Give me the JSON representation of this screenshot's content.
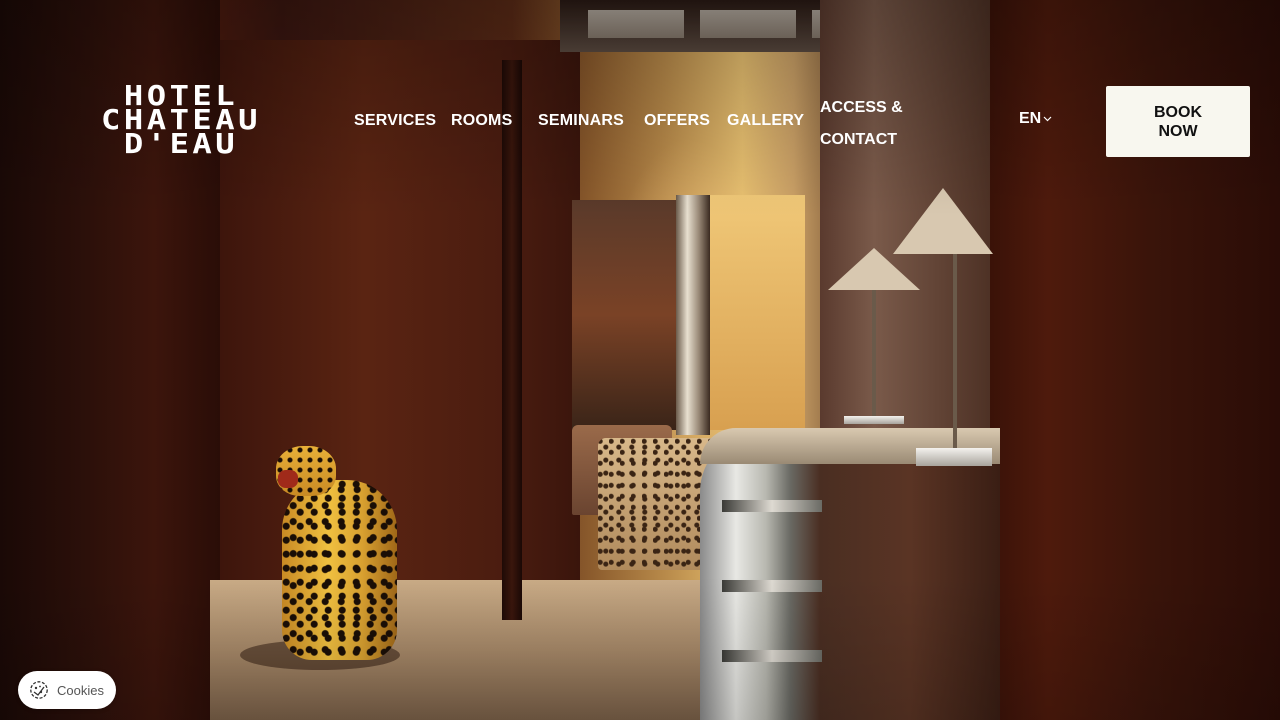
{
  "brand": {
    "logo_line1": "HOTEL",
    "logo_line2": "CHATEAU",
    "logo_line3": "D'EAU"
  },
  "nav": {
    "items": [
      {
        "label": "SERVICES"
      },
      {
        "label": "ROOMS"
      },
      {
        "label": "SEMINARS"
      },
      {
        "label": "OFFERS"
      },
      {
        "label": "GALLERY"
      }
    ],
    "access_line1": "ACCESS &",
    "access_line2": "CONTACT"
  },
  "language": {
    "selected": "EN",
    "icon": "chevron-down-icon"
  },
  "booking": {
    "line1": "BOOK",
    "line2": "NOW",
    "background": "#f8f7ef"
  },
  "cookies": {
    "label": "Cookies",
    "icon": "cookie-icon"
  },
  "hero": {
    "description_icon": "hotel-lobby-photo"
  }
}
